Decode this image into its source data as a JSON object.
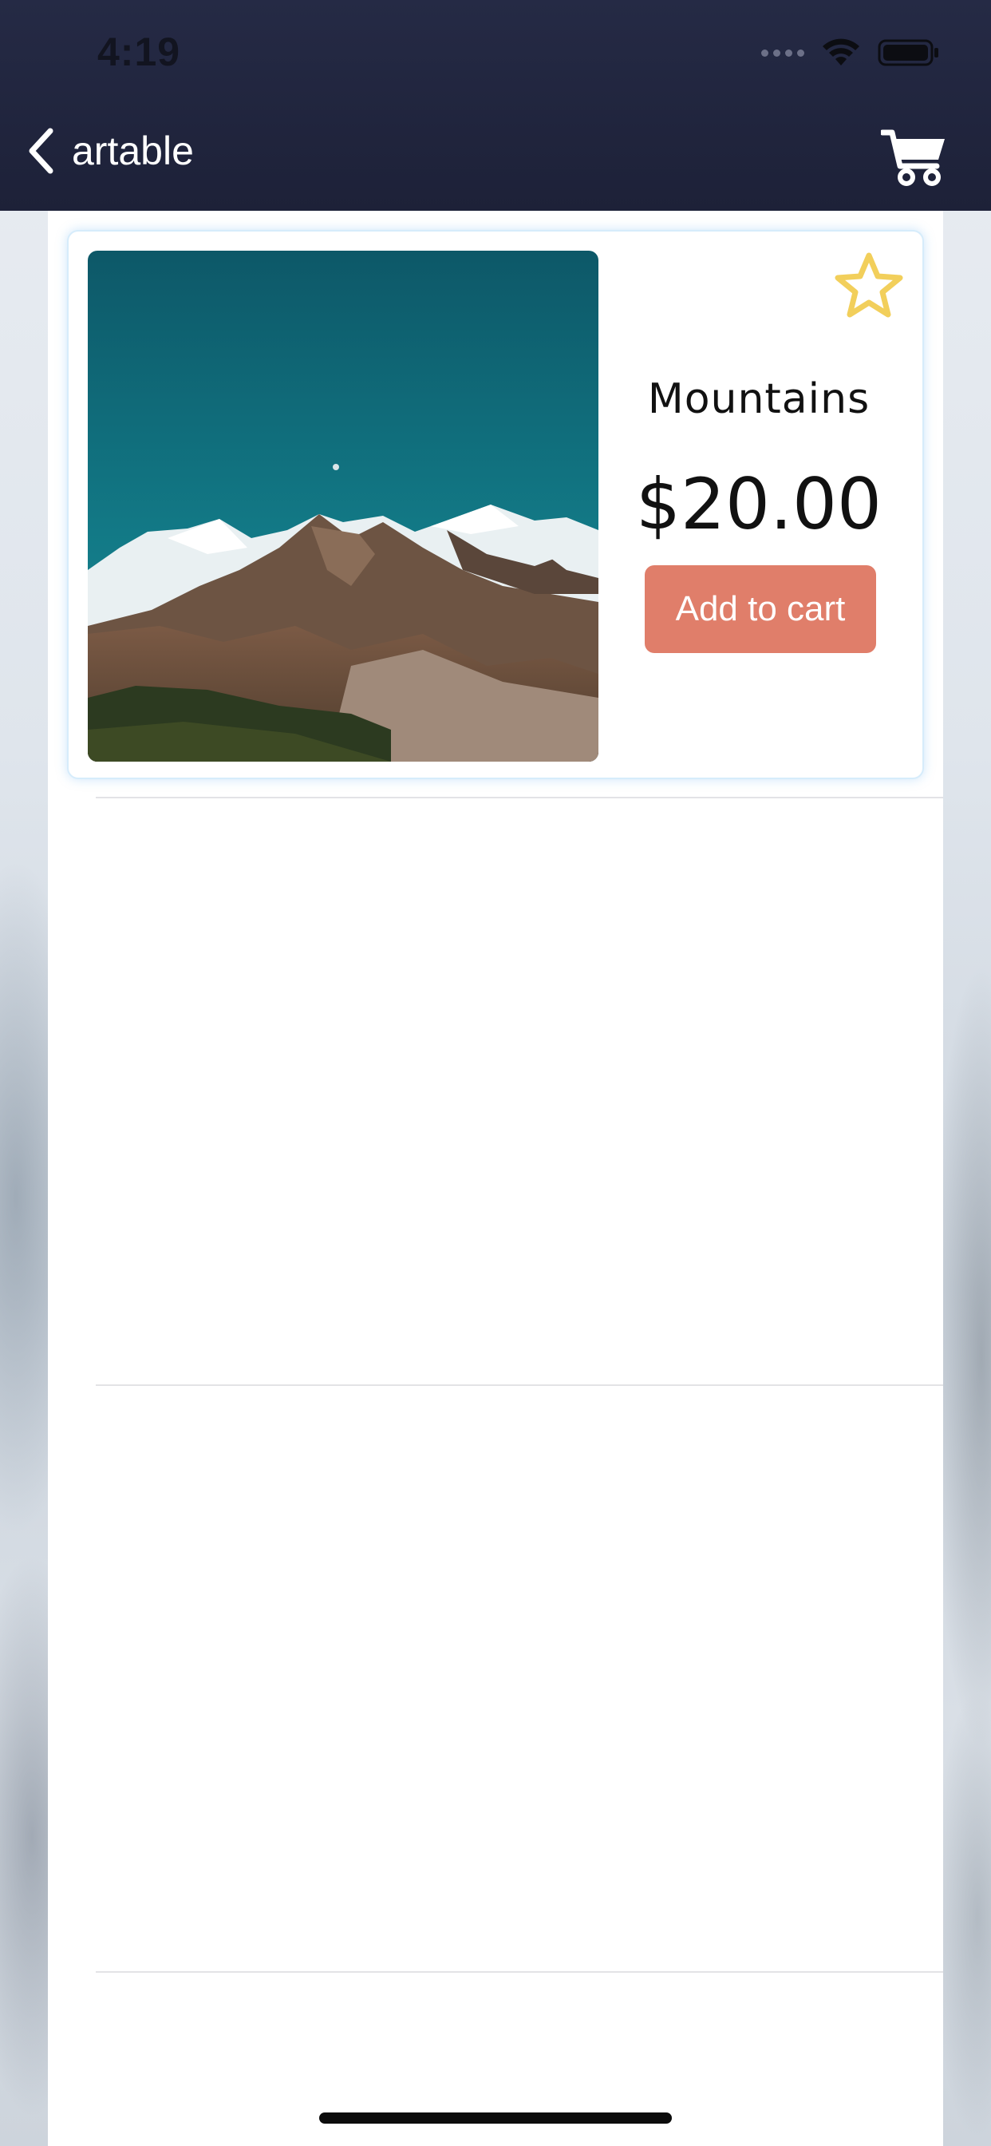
{
  "status_bar": {
    "time": "4:19"
  },
  "nav": {
    "back_title": "artable",
    "back_icon": "chevron-left-icon",
    "cart_icon": "shopping-cart-icon"
  },
  "product": {
    "name": "Mountains",
    "price": "$20.00",
    "add_to_cart_label": "Add to cart",
    "favorite_icon": "star-outline-icon",
    "image_subject": "snow-capped mountains under teal sky"
  },
  "colors": {
    "nav_background": "#1f2339",
    "add_to_cart": "#e07e6a",
    "star": "#f2cf5b",
    "card_glow": "#d6ecfb"
  }
}
